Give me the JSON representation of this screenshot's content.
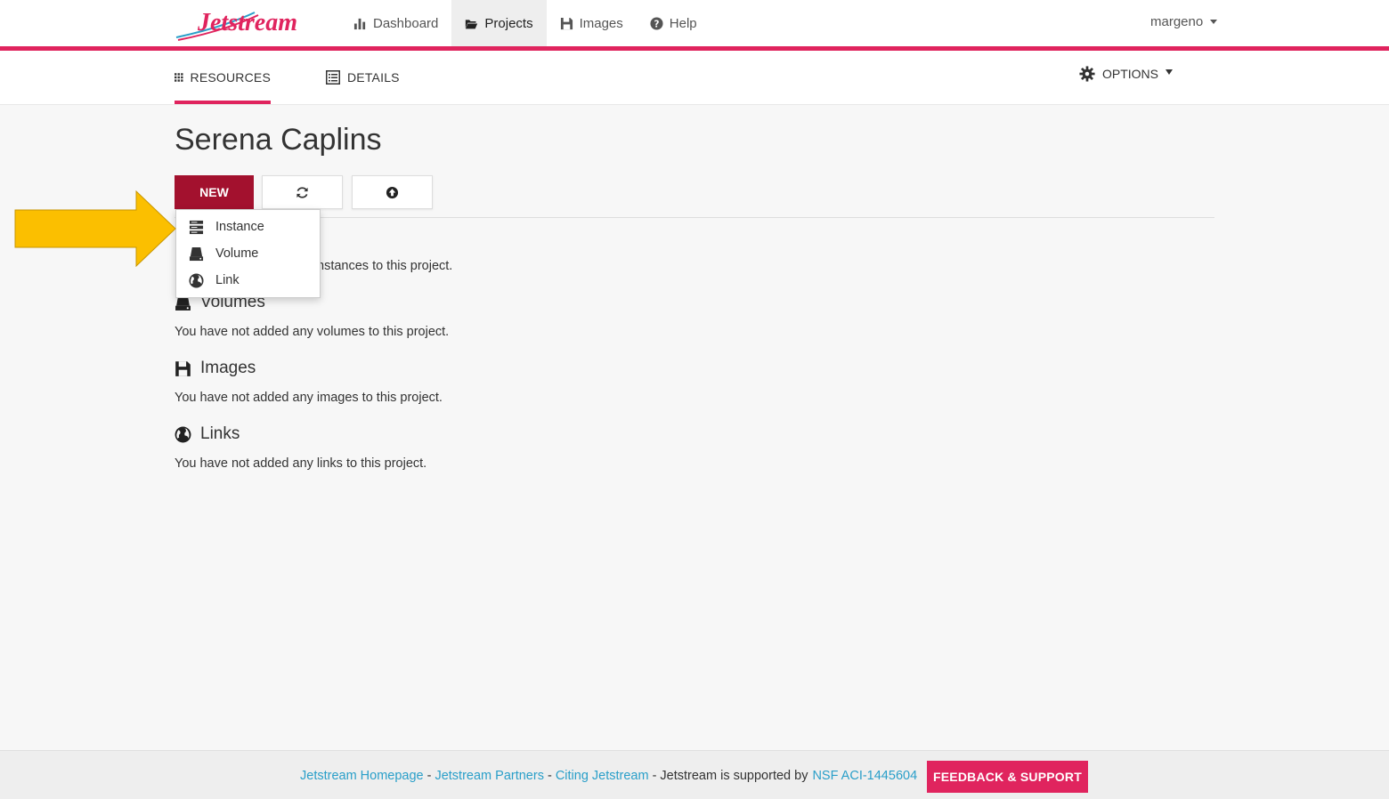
{
  "brand": {
    "logo_text": "Jetstream",
    "accent": "#e0245e",
    "dark_accent": "#a3112e",
    "link_color": "#2a9fc9"
  },
  "topnav": {
    "items": [
      {
        "label": "Dashboard",
        "icon": "bar-chart-icon"
      },
      {
        "label": "Projects",
        "icon": "folder-open-icon",
        "active": true
      },
      {
        "label": "Images",
        "icon": "floppy-disk-icon"
      },
      {
        "label": "Help",
        "icon": "question-circle-icon"
      }
    ],
    "user": "margeno"
  },
  "subnav": {
    "resources": "RESOURCES",
    "details": "DETAILS",
    "options": "OPTIONS"
  },
  "project": {
    "title": "Serena Caplins"
  },
  "toolbar": {
    "new_label": "NEW"
  },
  "dropdown": {
    "items": [
      {
        "label": "Instance",
        "icon": "server-icon"
      },
      {
        "label": "Volume",
        "icon": "hard-drive-icon"
      },
      {
        "label": "Link",
        "icon": "globe-icon"
      }
    ]
  },
  "sections": {
    "instances_text_partial": "nstances to this project.",
    "volumes": {
      "heading": "Volumes",
      "text": "You have not added any volumes to this project."
    },
    "images": {
      "heading": "Images",
      "text": "You have not added any images to this project."
    },
    "links": {
      "heading": "Links",
      "text": "You have not added any links to this project."
    }
  },
  "footer": {
    "homepage": "Jetstream Homepage",
    "partners": "Jetstream Partners",
    "citing": "Citing Jetstream",
    "supported_by": "Jetstream is supported by",
    "grant": "NSF ACI-1445604",
    "sep": "-",
    "feedback": "FEEDBACK & SUPPORT"
  },
  "annotation": {
    "arrow_color": "#fbbf00"
  }
}
